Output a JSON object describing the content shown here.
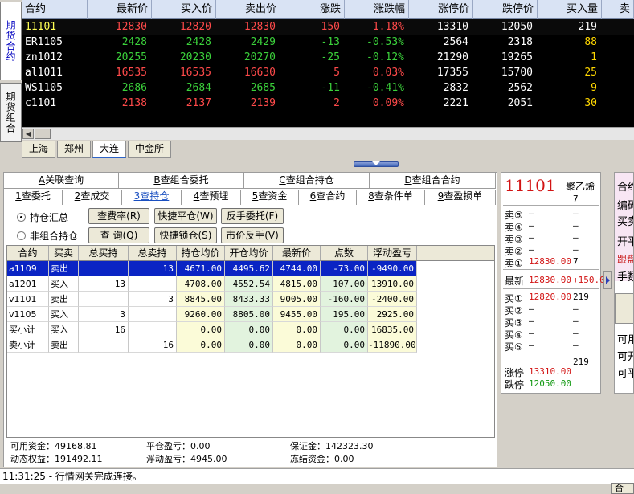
{
  "left_tabs": [
    "期货合约",
    "期货组合"
  ],
  "quote": {
    "headers": [
      "合约",
      "最新价",
      "买入价",
      "卖出价",
      "涨跌",
      "涨跌幅",
      "涨停价",
      "跌停价",
      "买入量",
      "卖"
    ],
    "rows": [
      {
        "name": "11101",
        "last": "12830",
        "bid": "12820",
        "ask": "12830",
        "chg": "150",
        "pct": "1.18%",
        "up": "13310",
        "down": "12050",
        "bidvol": "219"
      },
      {
        "name": "ER1105",
        "last": "2428",
        "bid": "2428",
        "ask": "2429",
        "chg": "-13",
        "pct": "-0.53%",
        "up": "2564",
        "down": "2318",
        "bidvol": "88"
      },
      {
        "name": "zn1012",
        "last": "20255",
        "bid": "20230",
        "ask": "20270",
        "chg": "-25",
        "pct": "-0.12%",
        "up": "21290",
        "down": "19265",
        "bidvol": "1"
      },
      {
        "name": "al1011",
        "last": "16535",
        "bid": "16535",
        "ask": "16630",
        "chg": "5",
        "pct": "0.03%",
        "up": "17355",
        "down": "15700",
        "bidvol": "25"
      },
      {
        "name": "WS1105",
        "last": "2686",
        "bid": "2684",
        "ask": "2685",
        "chg": "-11",
        "pct": "-0.41%",
        "up": "2832",
        "down": "2562",
        "bidvol": "9"
      },
      {
        "name": "c1101",
        "last": "2138",
        "bid": "2137",
        "ask": "2139",
        "chg": "2",
        "pct": "0.09%",
        "up": "2221",
        "down": "2051",
        "bidvol": "30"
      }
    ]
  },
  "exchange_tabs": [
    "上海",
    "郑州",
    "大连",
    "中金所"
  ],
  "top_tabs": [
    {
      "key": "A",
      "label": "关联查询"
    },
    {
      "key": "B",
      "label": "查组合委托"
    },
    {
      "key": "C",
      "label": "查组合持仓"
    },
    {
      "key": "D",
      "label": "查组合合约"
    }
  ],
  "sub_tabs": [
    {
      "key": "1",
      "label": "查委托"
    },
    {
      "key": "2",
      "label": "查成交"
    },
    {
      "key": "3",
      "label": "查持仓"
    },
    {
      "key": "4",
      "label": "查预埋"
    },
    {
      "key": "5",
      "label": "查资金"
    },
    {
      "key": "6",
      "label": "查合约"
    },
    {
      "key": "8",
      "label": "查条件单"
    },
    {
      "key": "9",
      "label": "查盈损单"
    }
  ],
  "options": {
    "summary": "持仓汇总",
    "detail": "非组合持仓"
  },
  "buttons": {
    "fee": "查费率(R)",
    "quick_close": "快捷平仓(W)",
    "reverse_order": "反手委托(F)",
    "query": "查 询(Q)",
    "quick_lock": "快捷锁仓(S)",
    "market_reverse": "市价反手(V)"
  },
  "grid": {
    "headers": [
      "合约",
      "买卖",
      "总买持",
      "总卖持",
      "持仓均价",
      "开仓均价",
      "最新价",
      "点数",
      "浮动盈亏"
    ],
    "rows": [
      [
        "a1109",
        "卖出",
        "",
        "13",
        "4671.00",
        "4495.62",
        "4744.00",
        "-73.00",
        "-9490.00"
      ],
      [
        "a1201",
        "买入",
        "13",
        "",
        "4708.00",
        "4552.54",
        "4815.00",
        "107.00",
        "13910.00"
      ],
      [
        "v1101",
        "卖出",
        "",
        "3",
        "8845.00",
        "8433.33",
        "9005.00",
        "-160.00",
        "-2400.00"
      ],
      [
        "v1105",
        "买入",
        "3",
        "",
        "9260.00",
        "8805.00",
        "9455.00",
        "195.00",
        "2925.00"
      ],
      [
        "买小计",
        "买入",
        "16",
        "",
        "0.00",
        "0.00",
        "0.00",
        "0.00",
        "16835.00"
      ],
      [
        "卖小计",
        "卖出",
        "",
        "16",
        "0.00",
        "0.00",
        "0.00",
        "0.00",
        "-11890.00"
      ]
    ]
  },
  "summary": {
    "available": "可用资金：49168.81",
    "dynamic": "动态权益：191492.11",
    "close_pl": "平仓盈亏：0.00",
    "float_pl": "浮动盈亏：4945.00",
    "margin": "保证金：142323.30",
    "frozen": "冻结资金：0.00"
  },
  "book": {
    "code": "11101",
    "product": "聚乙烯",
    "top_vol": "7",
    "asks": [
      {
        "label": "卖⑤",
        "price": "–",
        "vol": "–"
      },
      {
        "label": "卖④",
        "price": "–",
        "vol": "–"
      },
      {
        "label": "卖③",
        "price": "–",
        "vol": "–"
      },
      {
        "label": "卖②",
        "price": "–",
        "vol": "–"
      },
      {
        "label": "卖①",
        "price": "12830.00",
        "vol": "7"
      }
    ],
    "last_label": "最新",
    "last_price": "12830.00",
    "last_chg": "+150.0",
    "bids": [
      {
        "label": "买①",
        "price": "12820.00",
        "vol": "219"
      },
      {
        "label": "买②",
        "price": "–",
        "vol": "–"
      },
      {
        "label": "买③",
        "price": "–",
        "vol": "–"
      },
      {
        "label": "买④",
        "price": "–",
        "vol": "–"
      },
      {
        "label": "买⑤",
        "price": "–",
        "vol": "–"
      }
    ],
    "bottom_vol": "219",
    "limit_up_label": "涨停",
    "limit_up": "13310.00",
    "limit_down_label": "跌停",
    "limit_down": "12050.00"
  },
  "order_panel": [
    "合约",
    "编码",
    "买卖",
    "开平",
    "跟盘",
    "手数",
    "可用",
    "可开",
    "可平"
  ],
  "status": "11:31:25 - 行情网关完成连接。",
  "bottom_button": "合"
}
